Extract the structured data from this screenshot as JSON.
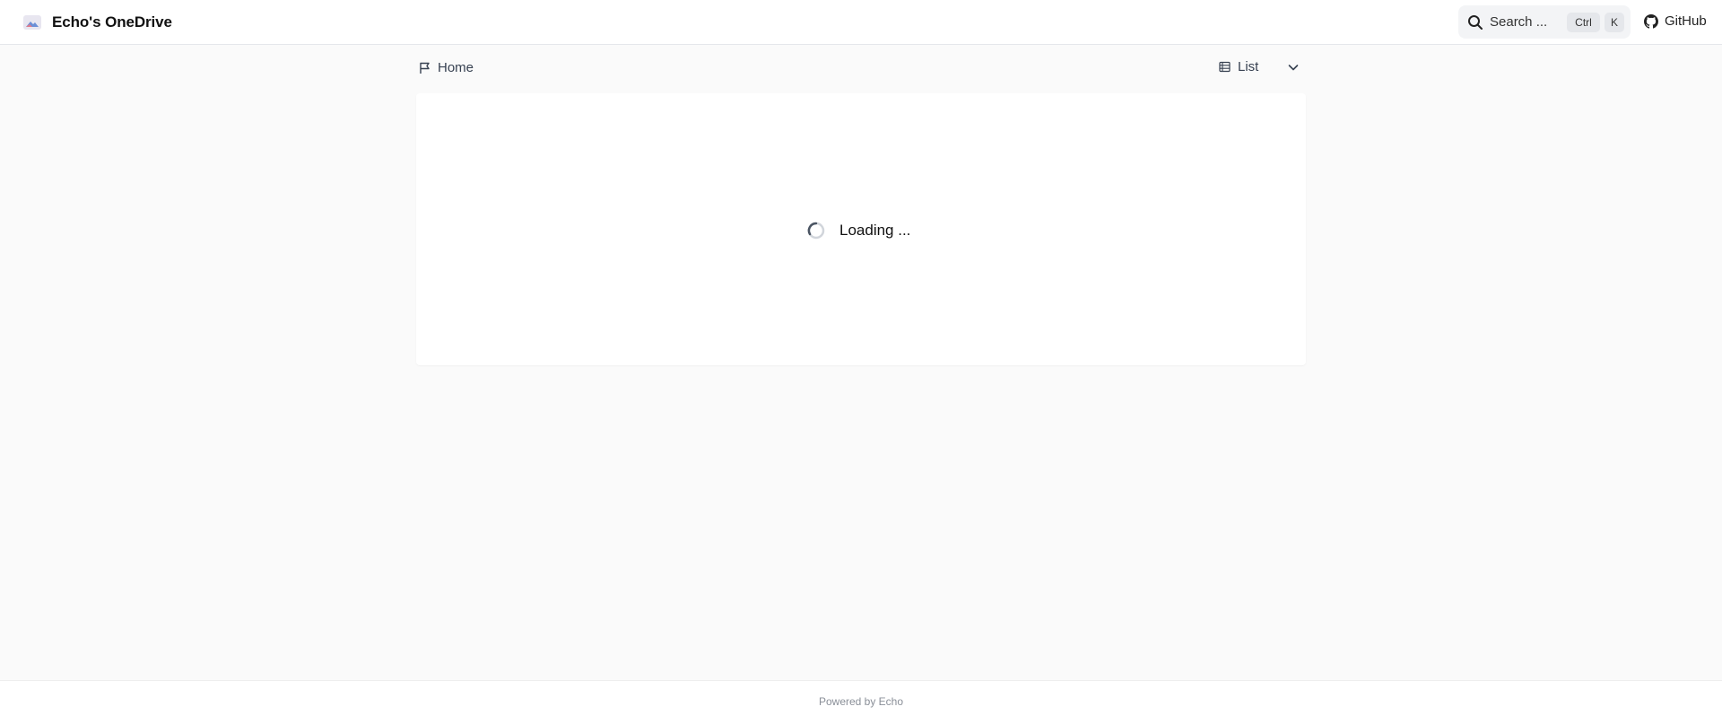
{
  "header": {
    "brand_title": "Echo's OneDrive",
    "search_placeholder": "Search ...",
    "shortcut_ctrl": "Ctrl",
    "shortcut_key": "K",
    "github_label": "GitHub"
  },
  "breadcrumb": {
    "home_label": "Home"
  },
  "view": {
    "selected": "List"
  },
  "content": {
    "loading_text": "Loading ..."
  },
  "footer": {
    "powered_by": "Powered by Echo"
  },
  "icons": {
    "logo": "onedrive-logo-icon",
    "search": "search-icon",
    "github": "github-icon",
    "home": "flag-icon",
    "view": "list-icon",
    "dropdown": "chevron-down-icon",
    "loading": "spinner-icon"
  },
  "colors": {
    "page_background": "#fafafa",
    "card_background": "#ffffff",
    "search_background": "#f3f4f6",
    "kbd_background": "#e5e7eb"
  }
}
